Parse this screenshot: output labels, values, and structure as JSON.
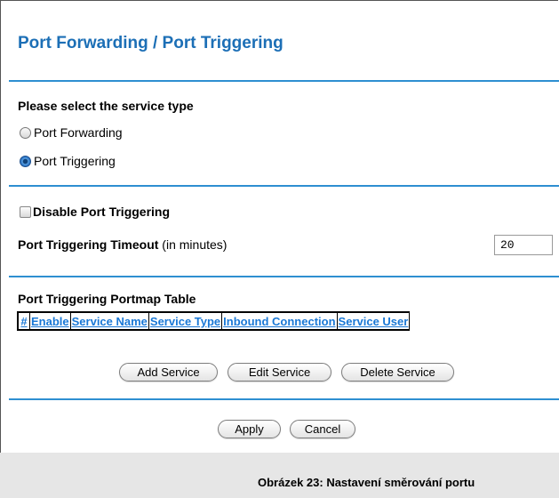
{
  "page": {
    "title": "Port Forwarding / Port Triggering"
  },
  "service_type": {
    "heading": "Please select the service type",
    "options": [
      {
        "label": "Port Forwarding",
        "selected": false
      },
      {
        "label": "Port Triggering",
        "selected": true
      }
    ]
  },
  "triggering": {
    "disable_label": "Disable Port Triggering",
    "disable_checked": false,
    "timeout_label_bold": "Port Triggering Timeout",
    "timeout_label_rest": " (in minutes)",
    "timeout_value": "20"
  },
  "portmap": {
    "heading": "Port Triggering Portmap Table",
    "columns": [
      "#",
      "Enable",
      "Service Name",
      "Service Type",
      "Inbound Connection",
      "Service User"
    ]
  },
  "buttons": {
    "add": "Add Service",
    "edit": "Edit Service",
    "delete": "Delete Service",
    "apply": "Apply",
    "cancel": "Cancel"
  },
  "caption": "Obrázek 23: Nastavení směrování portu",
  "colors": {
    "accent": "#1c6fb6",
    "rule": "#2e8fd1",
    "column_header": "#1a78d6",
    "footer_bg": "#e6e6e6"
  }
}
